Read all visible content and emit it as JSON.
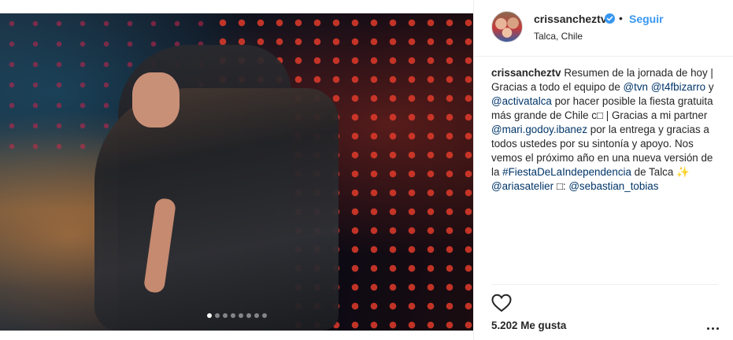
{
  "post": {
    "user": {
      "username": "crissancheztv",
      "verified": true,
      "follow_label": "Seguir",
      "separator": "•",
      "location": "Talca, Chile"
    },
    "caption": {
      "username": "crissancheztv",
      "segments": [
        {
          "text": " Resumen de la jornada de hoy | Gracias a todo el equipo de ",
          "link": false
        },
        {
          "text": "@tvn",
          "link": true
        },
        {
          "text": " ",
          "link": false
        },
        {
          "text": "@t4fbizarro",
          "link": true
        },
        {
          "text": " y ",
          "link": false
        },
        {
          "text": "@activatalca",
          "link": true
        },
        {
          "text": " por hacer posible la fiesta gratuita más grande de Chile c□ | Gracias a mi partner ",
          "link": false
        },
        {
          "text": "@mari.godoy.ibanez",
          "link": true
        },
        {
          "text": " por la entrega y gracias a todos ustedes por su sintonía y apoyo. Nos vemos el próximo año en una nueva versión de la ",
          "link": false
        },
        {
          "text": "#FiestaDeLaIndependencia",
          "link": true
        },
        {
          "text": " de Talca ✨ ",
          "link": false
        },
        {
          "text": "@ariasatelier",
          "link": true
        },
        {
          "text": " □: ",
          "link": false
        },
        {
          "text": "@sebastian_tobias",
          "link": true
        }
      ]
    },
    "likes_label": "5.202 Me gusta",
    "carousel": {
      "total": 8,
      "active_index": 0
    }
  },
  "icons": {
    "heart": "heart-outline-icon",
    "more": "more-options-icon",
    "verified": "verified-badge-icon"
  },
  "colors": {
    "link": "#003569",
    "follow": "#3897f0",
    "verified": "#3897f0",
    "text": "#262626",
    "divider": "#efefef"
  }
}
